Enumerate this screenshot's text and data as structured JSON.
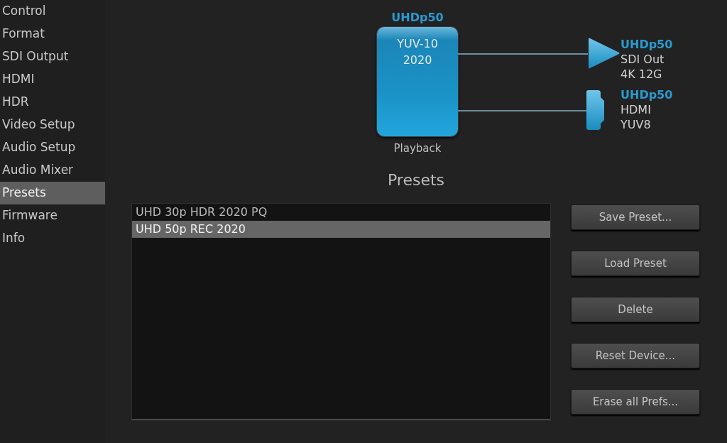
{
  "sidebar": {
    "items": [
      {
        "label": "Control",
        "selected": false
      },
      {
        "label": "Format",
        "selected": false
      },
      {
        "label": "SDI Output",
        "selected": false
      },
      {
        "label": "HDMI",
        "selected": false
      },
      {
        "label": "HDR",
        "selected": false
      },
      {
        "label": "Video Setup",
        "selected": false
      },
      {
        "label": "Audio Setup",
        "selected": false
      },
      {
        "label": "Audio Mixer",
        "selected": false
      },
      {
        "label": "Presets",
        "selected": true
      },
      {
        "label": "Firmware",
        "selected": false
      },
      {
        "label": "Info",
        "selected": false
      }
    ]
  },
  "diagram": {
    "input": {
      "format": "UHDp50",
      "lines": [
        "YUV-10",
        "2020"
      ],
      "label": "Playback"
    },
    "outputs": [
      {
        "kind": "sdi",
        "format": "UHDp50",
        "lines": [
          "SDI Out",
          "4K 12G"
        ]
      },
      {
        "kind": "hdmi",
        "format": "UHDp50",
        "lines": [
          "HDMI",
          "YUV8"
        ]
      }
    ]
  },
  "presets": {
    "title": "Presets",
    "items": [
      {
        "label": "UHD 30p HDR 2020 PQ",
        "selected": false
      },
      {
        "label": "UHD 50p REC 2020",
        "selected": true
      }
    ],
    "buttons": [
      "Save Preset...",
      "Load Preset",
      "Delete",
      "Reset Device...",
      "Erase all Prefs..."
    ]
  }
}
